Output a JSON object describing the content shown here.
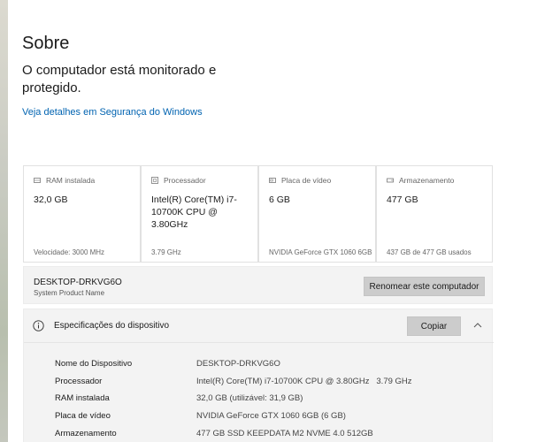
{
  "page": {
    "title": "Sobre",
    "status": "O computador está monitorado e protegido.",
    "security_link": "Veja detalhes em Segurança do Windows"
  },
  "cards": [
    {
      "label": "RAM instalada",
      "value": "32,0 GB",
      "footer": "Velocidade: 3000 MHz",
      "icon": "ram-icon"
    },
    {
      "label": "Processador",
      "value": "Intel(R) Core(TM) i7-10700K CPU @ 3.80GHz",
      "footer": "3.79 GHz",
      "icon": "processor-icon"
    },
    {
      "label": "Placa de vídeo",
      "value": "6 GB",
      "footer": "NVIDIA GeForce GTX 1060 6GB",
      "icon": "gpu-icon"
    },
    {
      "label": "Armazenamento",
      "value": "477 GB",
      "footer": "437 GB de 477 GB usados",
      "icon": "storage-icon"
    }
  ],
  "device": {
    "name": "DESKTOP-DRKVG6O",
    "product_name": "System Product Name",
    "rename_label": "Renomear este computador"
  },
  "specs": {
    "title": "Especificações do dispositivo",
    "copy_label": "Copiar",
    "rows": [
      {
        "key": "Nome do Dispositivo",
        "value": "DESKTOP-DRKVG6O"
      },
      {
        "key": "Processador",
        "value": "Intel(R) Core(TM) i7-10700K CPU @ 3.80GHz   3.79 GHz"
      },
      {
        "key": "RAM instalada",
        "value": "32,0 GB (utilizável: 31,9 GB)"
      },
      {
        "key": "Placa de vídeo",
        "value": "NVIDIA GeForce GTX 1060 6GB (6 GB)"
      },
      {
        "key": "Armazenamento",
        "value": "477 GB SSD KEEPDATA M2 NVME 4.0 512GB"
      }
    ]
  },
  "colors": {
    "link": "#0063b1",
    "button": "#cccccc",
    "panel": "#f3f3f3"
  }
}
